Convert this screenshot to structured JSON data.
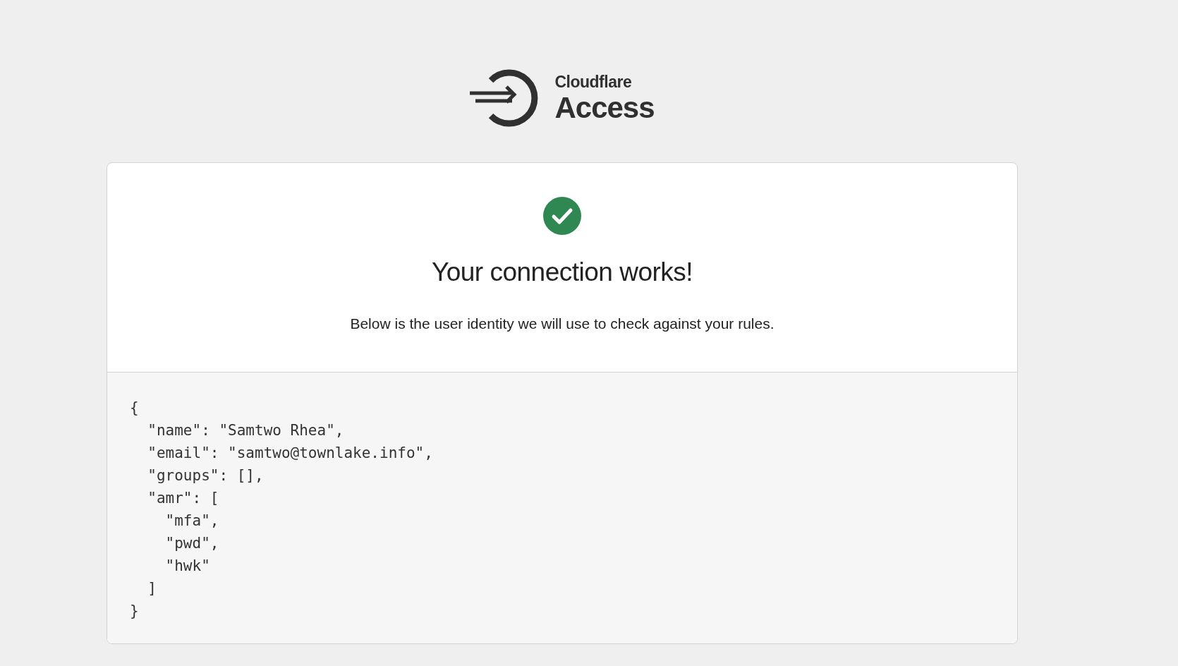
{
  "logo": {
    "brand": "Cloudflare",
    "product": "Access"
  },
  "card": {
    "success": true,
    "title": "Your connection works!",
    "subtitle": "Below is the user identity we will use to check against your rules.",
    "code_lines": [
      "{",
      "  \"name\": \"Samtwo Rhea\",",
      "  \"email\": \"samtwo@townlake.info\",",
      "  \"groups\": [],",
      "  \"amr\": [",
      "    \"mfa\",",
      "    \"pwd\",",
      "    \"hwk\"",
      "  ]",
      "}"
    ]
  }
}
